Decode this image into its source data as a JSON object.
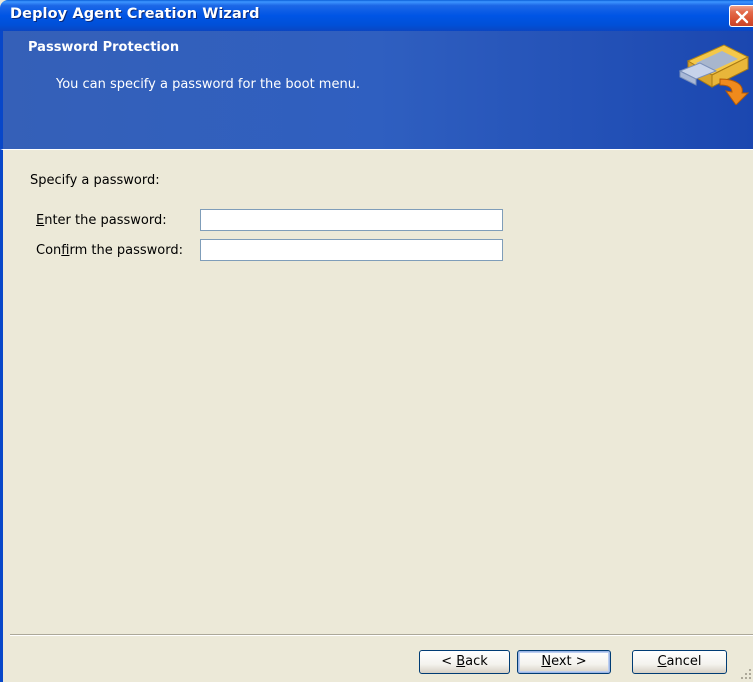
{
  "window": {
    "title": "Deploy Agent Creation Wizard"
  },
  "header": {
    "title": "Password Protection",
    "subtitle": "You can specify a password for the boot menu.",
    "icon": "wizard-disk-arrow-icon"
  },
  "form": {
    "section_label": "Specify a password:",
    "fields": [
      {
        "label_mnemonic": "E",
        "label_rest": "nter the password:",
        "value": "",
        "placeholder": ""
      },
      {
        "label_prefix": "Con",
        "label_mnemonic": "f",
        "label_rest": "irm the password:",
        "value": "",
        "placeholder": ""
      }
    ]
  },
  "buttons": {
    "back": {
      "prefix": "< ",
      "mnemonic": "B",
      "rest": "ack"
    },
    "next": {
      "mnemonic": "N",
      "rest": "ext >"
    },
    "cancel": {
      "mnemonic": "C",
      "rest": "ancel"
    }
  },
  "colors": {
    "title_bar": "#0055e5",
    "header_band": "#2f5fc0",
    "dialog_face": "#ece9d8",
    "close_button": "#d9502f",
    "input_border": "#7f9db9"
  }
}
